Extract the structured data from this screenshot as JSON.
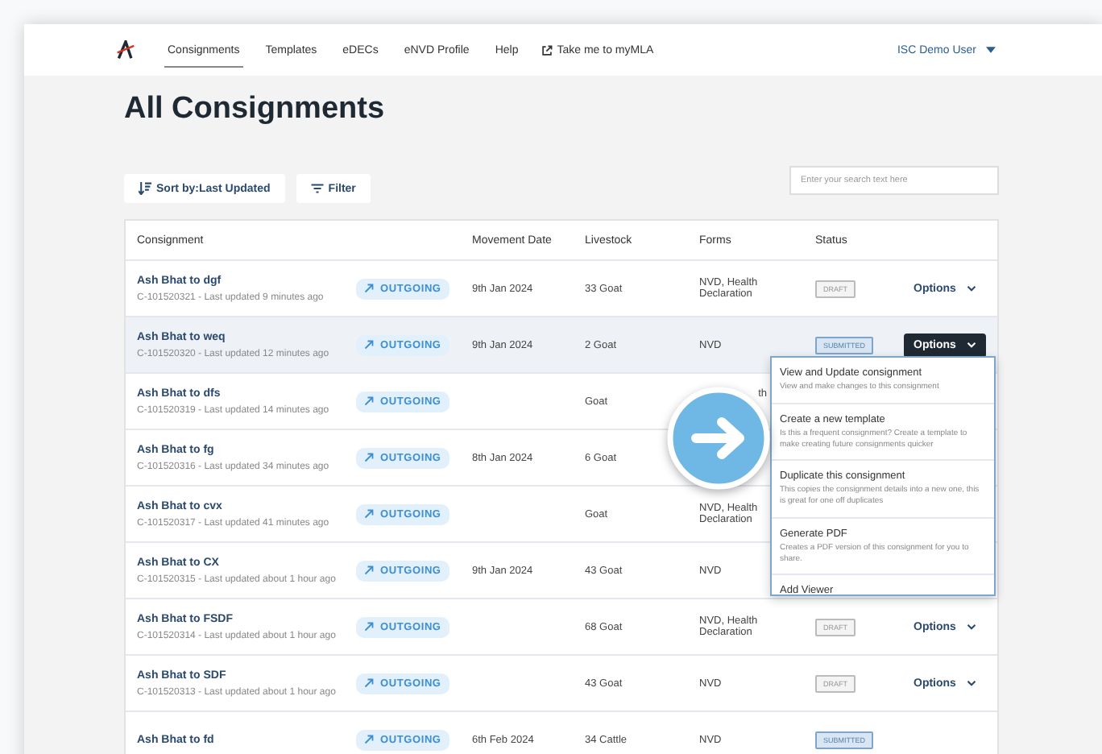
{
  "nav": {
    "tabs": [
      {
        "label": "Consignments",
        "selected": true
      },
      {
        "label": "Templates",
        "selected": false
      },
      {
        "label": "eDECs",
        "selected": false
      },
      {
        "label": "eNVD Profile",
        "selected": false
      },
      {
        "label": "Help",
        "selected": false
      }
    ],
    "external_link": "Take me to myMLA",
    "user": "ISC Demo User"
  },
  "title": "All Consignments",
  "toolbar": {
    "sort": "Sort by:Last Updated",
    "filter": "Filter",
    "search": {
      "placeholder": "Enter your search text here"
    }
  },
  "table": {
    "columns": [
      "Consignment",
      "Movement Date",
      "Livestock",
      "Forms",
      "Status"
    ],
    "rows": [
      {
        "name": "Ash Bhat to dgf",
        "meta": "C-101520321 - Last updated 9 minutes ago",
        "direction": "OUTGOING",
        "date": "9th Jan 2024",
        "livestock": "33 Goat",
        "forms": "NVD, Health Declaration",
        "status": "DRAFT",
        "options": "Options",
        "selected": false
      },
      {
        "name": "Ash Bhat to weq",
        "meta": "C-101520320 - Last updated 12 minutes ago",
        "direction": "OUTGOING",
        "date": "9th Jan 2024",
        "livestock": "2 Goat",
        "forms": "NVD",
        "status": "SUBMITTED",
        "options": "Options",
        "selected": true
      },
      {
        "name": "Ash Bhat to dfs",
        "meta": "C-101520319 - Last updated 14 minutes ago",
        "direction": "OUTGOING",
        "livestock": "Goat",
        "forms": "th",
        "forms_partly_covered": true,
        "selected": false
      },
      {
        "name": "Ash Bhat to fg",
        "meta": "C-101520316 - Last updated 34 minutes ago",
        "direction": "OUTGOING",
        "date": "8th Jan 2024",
        "livestock": "6 Goat",
        "selected": false
      },
      {
        "name": "Ash Bhat to cvx",
        "meta": "C-101520317 - Last updated 41 minutes ago",
        "direction": "OUTGOING",
        "livestock": "Goat",
        "forms": "NVD, Health Declaration",
        "selected": false
      },
      {
        "name": "Ash Bhat to CX",
        "meta": "C-101520315 - Last updated about 1 hour ago",
        "direction": "OUTGOING",
        "date": "9th Jan 2024",
        "livestock": "43 Goat",
        "forms": "NVD",
        "selected": false
      },
      {
        "name": "Ash Bhat to FSDF",
        "meta": "C-101520314 - Last updated about 1 hour ago",
        "direction": "OUTGOING",
        "livestock": "68 Goat",
        "forms": "NVD, Health Declaration",
        "status": "DRAFT",
        "options": "Options",
        "selected": false
      },
      {
        "name": "Ash Bhat to SDF",
        "meta": "C-101520313 - Last updated about 1 hour ago",
        "direction": "OUTGOING",
        "livestock": "43 Goat",
        "forms": "NVD",
        "status": "DRAFT",
        "options": "Options",
        "selected": false
      },
      {
        "name": "Ash Bhat to fd",
        "direction": "OUTGOING",
        "date": "6th Feb 2024",
        "livestock": "34 Cattle",
        "forms": "NVD",
        "status": "SUBMITTED",
        "selected": false
      }
    ]
  },
  "menu": {
    "items": [
      {
        "title": "View and Update consignment",
        "description": "View and make changes to this consignment"
      },
      {
        "title": "Create a new template",
        "description": "Is this a frequent consignment? Create a template to make creating future consignments quicker"
      },
      {
        "title": "Duplicate this consignment",
        "description": "This copies the consignment details into a new one, this is great for one off duplicates"
      },
      {
        "title": "Generate PDF",
        "description": "Creates a PDF version of this consignment for you to share."
      },
      {
        "title": "Add Viewer"
      }
    ]
  }
}
